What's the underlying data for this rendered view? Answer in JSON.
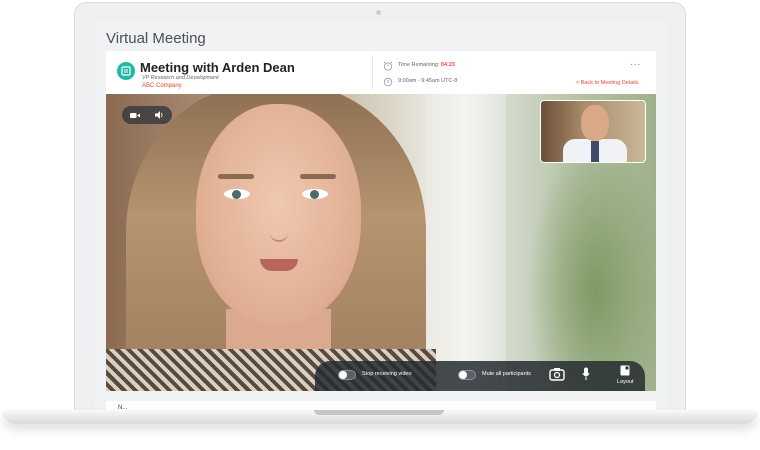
{
  "app_title": "Virtual Meeting",
  "meeting": {
    "title": "Meeting with Arden Dean",
    "role": "VP Research and Development",
    "company": "ABC Company"
  },
  "schedule": {
    "time_remaining_label": "Time Remaining:",
    "time_remaining_value": "04:23",
    "time_range": "9:00am - 9:45am UTC-8",
    "back_link": "< Back to Meeting Details",
    "more_label": "..."
  },
  "controls": {
    "stop_video_label": "Stop receiving video",
    "mute_all_label": "Mute all participants",
    "layout_label": "Layout"
  },
  "below": {
    "text": "N..."
  },
  "colors": {
    "accent": "#e64a2e",
    "teal": "#23b7a6"
  }
}
